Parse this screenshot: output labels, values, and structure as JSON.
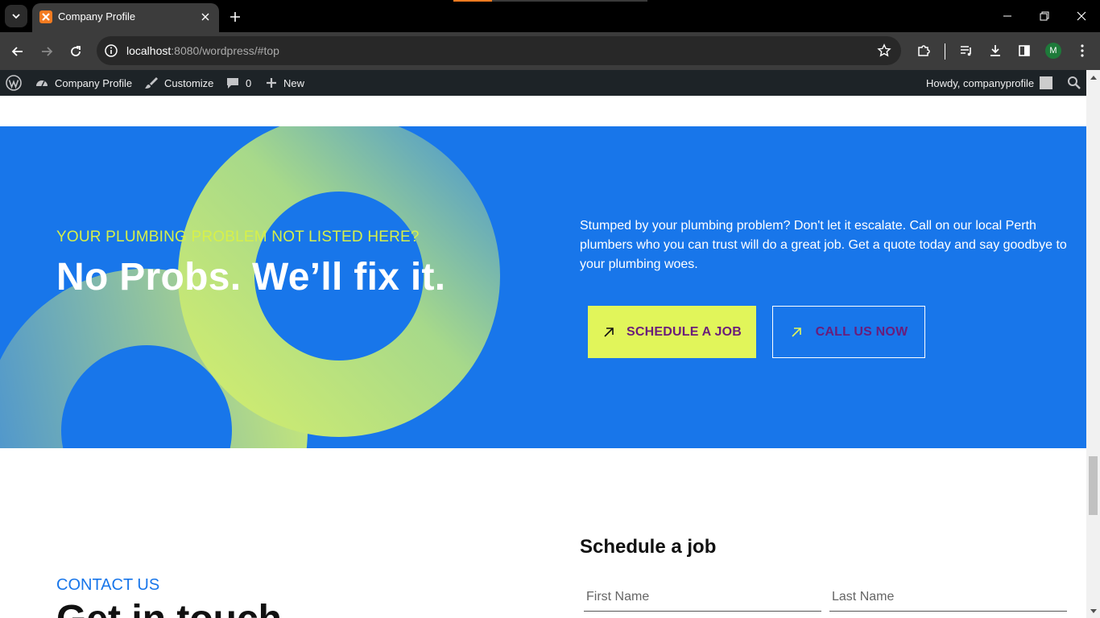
{
  "browser": {
    "tab_title": "Company Profile",
    "url_host": "localhost",
    "url_rest": ":8080/wordpress/#top",
    "profile_initial": "M"
  },
  "adminbar": {
    "site_name": "Company Profile",
    "customize": "Customize",
    "comments_count": "0",
    "new_label": "New",
    "howdy": "Howdy, companyprofile"
  },
  "hero": {
    "eyebrow": "YOUR PLUMBING PROBLEM NOT LISTED HERE?",
    "headline": "No Probs. We’ll fix it.",
    "copy": "Stumped by your plumbing problem? Don't let it escalate. Call on our local Perth plumbers who you can trust will do a great job. Get a quote today and say goodbye to your plumbing woes.",
    "primary_button": "SCHEDULE A JOB",
    "secondary_button": "CALL US NOW"
  },
  "contact": {
    "eyebrow": "CONTACT US",
    "title": "Get in touch"
  },
  "form": {
    "title": "Schedule a job",
    "first_name_placeholder": "First Name",
    "last_name_placeholder": "Last Name"
  },
  "colors": {
    "hero_bg": "#1876ea",
    "accent_yellow": "#e1f55a",
    "button_text": "#6a1d7a"
  },
  "icons": {
    "tab_list": "chevron-down-icon",
    "favicon": "xampp-icon",
    "close": "close-icon",
    "new_tab": "plus-icon",
    "back": "arrow-left-icon",
    "forward": "arrow-right-icon",
    "reload": "reload-icon",
    "info": "info-icon",
    "bookmark": "star-icon",
    "extensions": "puzzle-icon",
    "media": "playlist-icon",
    "downloads": "download-icon",
    "side_panel": "side-panel-icon",
    "menu": "kebab-menu-icon",
    "wordpress": "wordpress-logo-icon",
    "dashboard": "dashboard-icon",
    "customize": "brush-icon",
    "comments": "comment-icon",
    "add_new": "plus-icon",
    "search": "search-icon",
    "button_arrow": "arrow-up-right-icon"
  }
}
